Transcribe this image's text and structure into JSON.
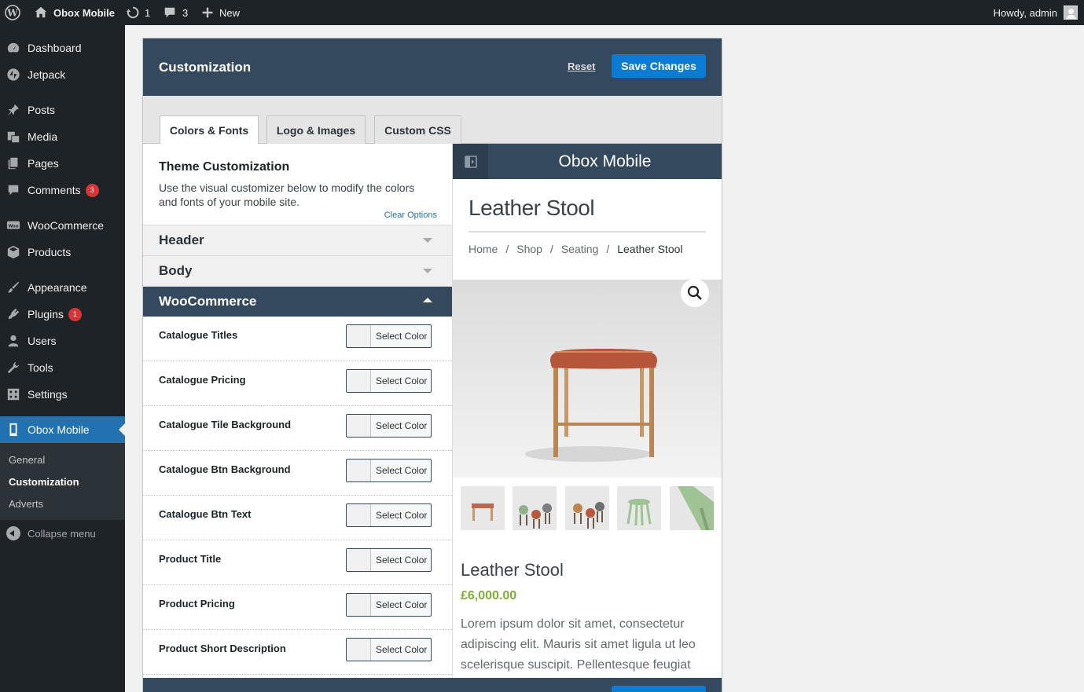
{
  "admin_bar": {
    "site_name": "Obox Mobile",
    "updates_count": "1",
    "comments_count": "3",
    "new_label": "New",
    "greeting": "Howdy, admin"
  },
  "sidebar": {
    "items": [
      {
        "label": "Dashboard",
        "icon": "dashboard-icon"
      },
      {
        "label": "Jetpack",
        "icon": "jetpack-icon"
      },
      {
        "label": "Posts",
        "icon": "pin-icon"
      },
      {
        "label": "Media",
        "icon": "media-icon"
      },
      {
        "label": "Pages",
        "icon": "pages-icon"
      },
      {
        "label": "Comments",
        "icon": "comment-icon",
        "badge": "3"
      },
      {
        "label": "WooCommerce",
        "icon": "woocommerce-icon"
      },
      {
        "label": "Products",
        "icon": "products-icon"
      },
      {
        "label": "Appearance",
        "icon": "brush-icon"
      },
      {
        "label": "Plugins",
        "icon": "plugin-icon",
        "badge": "1"
      },
      {
        "label": "Users",
        "icon": "users-icon"
      },
      {
        "label": "Tools",
        "icon": "wrench-icon"
      },
      {
        "label": "Settings",
        "icon": "settings-icon"
      },
      {
        "label": "Obox Mobile",
        "icon": "mobile-icon",
        "active": true
      }
    ],
    "submenu": [
      "General",
      "Customization",
      "Adverts"
    ],
    "collapse_label": "Collapse menu"
  },
  "panel": {
    "title": "Customization",
    "reset_label": "Reset",
    "save_label": "Save Changes",
    "tabs": [
      "Colors & Fonts",
      "Logo & Images",
      "Custom CSS"
    ],
    "active_tab": "Colors & Fonts"
  },
  "options": {
    "title": "Theme Customization",
    "description": "Use the visual customizer below to modify the colors and fonts of your mobile site.",
    "clear_label": "Clear Options",
    "sections": [
      "Header",
      "Body",
      "WooCommerce"
    ],
    "open_section": "WooCommerce",
    "select_color_label": "Select Color",
    "color_rows": [
      "Catalogue Titles",
      "Catalogue Pricing",
      "Catalogue Tile Background",
      "Catalogue Btn Background",
      "Catalogue Btn Text",
      "Product Title",
      "Product Pricing",
      "Product Short Description"
    ]
  },
  "preview": {
    "site_title": "Obox Mobile",
    "page_title": "Leather Stool",
    "breadcrumb": [
      "Home",
      "Shop",
      "Seating",
      "Leather Stool"
    ],
    "product_title": "Leather Stool",
    "price": "£6,000.00",
    "description": "Lorem ipsum dolor sit amet, consectetur adipiscing elit. Mauris sit amet ligula ut leo scelerisque suscipit. Pellentesque feugiat"
  },
  "colors": {
    "admin_dark": "#1d2327",
    "menu_active": "#2271b1",
    "panel_header": "#34495e",
    "save_button": "#0c7bd4",
    "price_green": "#7fad39",
    "badge_red": "#d63638"
  }
}
